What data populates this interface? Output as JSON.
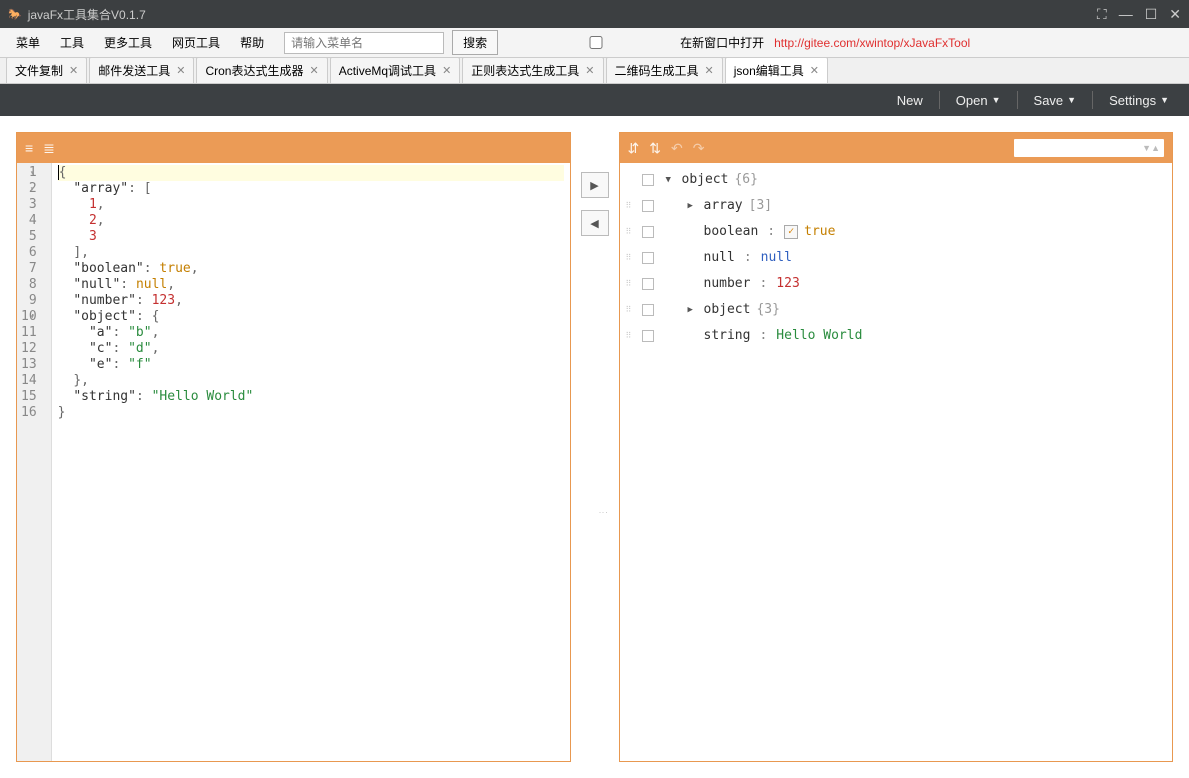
{
  "window": {
    "title": "javaFx工具集合V0.1.7"
  },
  "menu": {
    "items": [
      "菜单",
      "工具",
      "更多工具",
      "网页工具",
      "帮助"
    ],
    "search_placeholder": "请输入菜单名",
    "search_btn": "搜索",
    "new_window_chk": "在新窗口中打开",
    "link": "http://gitee.com/xwintop/xJavaFxTool"
  },
  "tabs": [
    {
      "label": "文件复制",
      "active": false
    },
    {
      "label": "邮件发送工具",
      "active": false
    },
    {
      "label": "Cron表达式生成器",
      "active": false
    },
    {
      "label": "ActiveMq调试工具",
      "active": false
    },
    {
      "label": "正则表达式生成工具",
      "active": false
    },
    {
      "label": "二维码生成工具",
      "active": false
    },
    {
      "label": "json编辑工具",
      "active": true
    }
  ],
  "toolbar": {
    "new": "New",
    "open": "Open",
    "save": "Save",
    "settings": "Settings"
  },
  "editor": {
    "lines": [
      {
        "n": 1,
        "fold": true,
        "hl": true,
        "tokens": [
          {
            "t": "punct",
            "v": "{"
          }
        ]
      },
      {
        "n": 2,
        "fold": true,
        "tokens": [
          {
            "t": "ind",
            "v": "  "
          },
          {
            "t": "key",
            "v": "\"array\""
          },
          {
            "t": "punct",
            "v": ": ["
          }
        ]
      },
      {
        "n": 3,
        "tokens": [
          {
            "t": "ind",
            "v": "    "
          },
          {
            "t": "num",
            "v": "1"
          },
          {
            "t": "punct",
            "v": ","
          }
        ]
      },
      {
        "n": 4,
        "tokens": [
          {
            "t": "ind",
            "v": "    "
          },
          {
            "t": "num",
            "v": "2"
          },
          {
            "t": "punct",
            "v": ","
          }
        ]
      },
      {
        "n": 5,
        "tokens": [
          {
            "t": "ind",
            "v": "    "
          },
          {
            "t": "num",
            "v": "3"
          }
        ]
      },
      {
        "n": 6,
        "tokens": [
          {
            "t": "ind",
            "v": "  "
          },
          {
            "t": "punct",
            "v": "],"
          }
        ]
      },
      {
        "n": 7,
        "tokens": [
          {
            "t": "ind",
            "v": "  "
          },
          {
            "t": "key",
            "v": "\"boolean\""
          },
          {
            "t": "punct",
            "v": ": "
          },
          {
            "t": "bool",
            "v": "true"
          },
          {
            "t": "punct",
            "v": ","
          }
        ]
      },
      {
        "n": 8,
        "tokens": [
          {
            "t": "ind",
            "v": "  "
          },
          {
            "t": "key",
            "v": "\"null\""
          },
          {
            "t": "punct",
            "v": ": "
          },
          {
            "t": "null",
            "v": "null"
          },
          {
            "t": "punct",
            "v": ","
          }
        ]
      },
      {
        "n": 9,
        "tokens": [
          {
            "t": "ind",
            "v": "  "
          },
          {
            "t": "key",
            "v": "\"number\""
          },
          {
            "t": "punct",
            "v": ": "
          },
          {
            "t": "num",
            "v": "123"
          },
          {
            "t": "punct",
            "v": ","
          }
        ]
      },
      {
        "n": 10,
        "fold": true,
        "tokens": [
          {
            "t": "ind",
            "v": "  "
          },
          {
            "t": "key",
            "v": "\"object\""
          },
          {
            "t": "punct",
            "v": ": {"
          }
        ]
      },
      {
        "n": 11,
        "tokens": [
          {
            "t": "ind",
            "v": "    "
          },
          {
            "t": "key",
            "v": "\"a\""
          },
          {
            "t": "punct",
            "v": ": "
          },
          {
            "t": "str",
            "v": "\"b\""
          },
          {
            "t": "punct",
            "v": ","
          }
        ]
      },
      {
        "n": 12,
        "tokens": [
          {
            "t": "ind",
            "v": "    "
          },
          {
            "t": "key",
            "v": "\"c\""
          },
          {
            "t": "punct",
            "v": ": "
          },
          {
            "t": "str",
            "v": "\"d\""
          },
          {
            "t": "punct",
            "v": ","
          }
        ]
      },
      {
        "n": 13,
        "tokens": [
          {
            "t": "ind",
            "v": "    "
          },
          {
            "t": "key",
            "v": "\"e\""
          },
          {
            "t": "punct",
            "v": ": "
          },
          {
            "t": "str",
            "v": "\"f\""
          }
        ]
      },
      {
        "n": 14,
        "tokens": [
          {
            "t": "ind",
            "v": "  "
          },
          {
            "t": "punct",
            "v": "},"
          }
        ]
      },
      {
        "n": 15,
        "tokens": [
          {
            "t": "ind",
            "v": "  "
          },
          {
            "t": "key",
            "v": "\"string\""
          },
          {
            "t": "punct",
            "v": ": "
          },
          {
            "t": "str",
            "v": "\"Hello World\""
          }
        ]
      },
      {
        "n": 16,
        "tokens": [
          {
            "t": "punct",
            "v": "}"
          }
        ]
      }
    ]
  },
  "tree": {
    "rows": [
      {
        "indent": 0,
        "handle": false,
        "expand": "down",
        "key": "object",
        "meta": "{6}"
      },
      {
        "indent": 1,
        "handle": true,
        "expand": "right",
        "key": "array",
        "meta": "[3]"
      },
      {
        "indent": 1,
        "handle": true,
        "expand": "",
        "key": "boolean",
        "colon": ":",
        "checkbox": true,
        "val": "true",
        "vt": "bool"
      },
      {
        "indent": 1,
        "handle": true,
        "expand": "",
        "key": "null",
        "colon": ":",
        "val": "null",
        "vt": "null"
      },
      {
        "indent": 1,
        "handle": true,
        "expand": "",
        "key": "number",
        "colon": ":",
        "val": "123",
        "vt": "num"
      },
      {
        "indent": 1,
        "handle": true,
        "expand": "right",
        "key": "object",
        "meta": "{3}"
      },
      {
        "indent": 1,
        "handle": true,
        "expand": "",
        "key": "string",
        "colon": ":",
        "val": "Hello World",
        "vt": "str"
      }
    ]
  }
}
